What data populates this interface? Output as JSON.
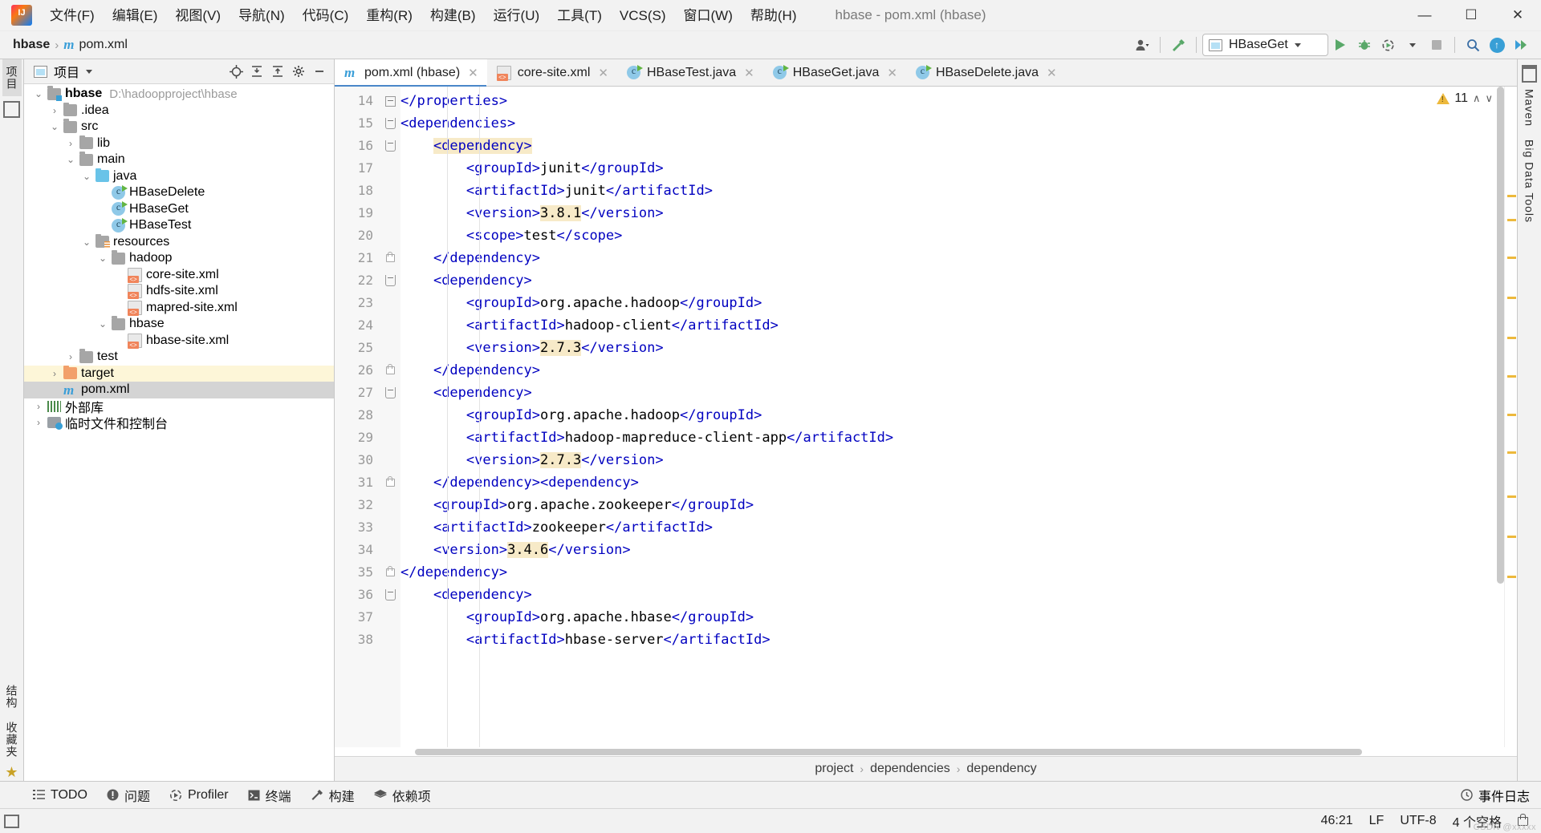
{
  "window": {
    "title": "hbase - pom.xml (hbase)",
    "minimize": "—",
    "maximize": "☐",
    "close": "✕"
  },
  "menubar": {
    "items": [
      {
        "label": "文件(F)"
      },
      {
        "label": "编辑(E)"
      },
      {
        "label": "视图(V)"
      },
      {
        "label": "导航(N)"
      },
      {
        "label": "代码(C)"
      },
      {
        "label": "重构(R)"
      },
      {
        "label": "构建(B)"
      },
      {
        "label": "运行(U)"
      },
      {
        "label": "工具(T)"
      },
      {
        "label": "VCS(S)"
      },
      {
        "label": "窗口(W)"
      },
      {
        "label": "帮助(H)"
      }
    ]
  },
  "navbar": {
    "crumbs": [
      {
        "label": "hbase",
        "bold": true
      },
      {
        "label": "pom.xml",
        "bold": false
      }
    ],
    "separator": "›",
    "run_configuration": "HBaseGet",
    "actions": {
      "avatar": "user-icon",
      "build": "hammer-icon",
      "run": "run-icon",
      "debug": "debug-icon",
      "run_with_coverage": "coverage-icon",
      "stop": "stop-icon",
      "search_everywhere": "magnifier-icon",
      "update": "update-icon",
      "search_next": "forward-icon"
    }
  },
  "left_strip": {
    "project_label": "项目",
    "structure_label": "结构",
    "favorites_label": "收藏夹"
  },
  "right_strip": {
    "maven_label": "Maven",
    "bigdata_label": "Big Data Tools"
  },
  "project_pane": {
    "title": "项目",
    "toolbar_icons": [
      "locate-icon",
      "collapse-all-icon",
      "expand-all-icon",
      "settings-gear-icon",
      "hide-icon"
    ],
    "tree": [
      {
        "depth": 0,
        "arrow": "⌄",
        "icon": "folder-module",
        "label": "hbase",
        "bold": true,
        "path": "D:\\hadoopproject\\hbase",
        "state": "normal"
      },
      {
        "depth": 1,
        "arrow": "›",
        "icon": "folder",
        "label": ".idea",
        "bold": false,
        "path": "",
        "state": "normal"
      },
      {
        "depth": 1,
        "arrow": "⌄",
        "icon": "folder",
        "label": "src",
        "bold": false,
        "path": "",
        "state": "normal"
      },
      {
        "depth": 2,
        "arrow": "›",
        "icon": "folder",
        "label": "lib",
        "bold": false,
        "path": "",
        "state": "normal"
      },
      {
        "depth": 2,
        "arrow": "⌄",
        "icon": "folder",
        "label": "main",
        "bold": false,
        "path": "",
        "state": "normal"
      },
      {
        "depth": 3,
        "arrow": "⌄",
        "icon": "folder-blue",
        "label": "java",
        "bold": false,
        "path": "",
        "state": "normal"
      },
      {
        "depth": 4,
        "arrow": "",
        "icon": "java-class",
        "label": "HBaseDelete",
        "bold": false,
        "path": "",
        "state": "normal"
      },
      {
        "depth": 4,
        "arrow": "",
        "icon": "java-class",
        "label": "HBaseGet",
        "bold": false,
        "path": "",
        "state": "normal"
      },
      {
        "depth": 4,
        "arrow": "",
        "icon": "java-class",
        "label": "HBaseTest",
        "bold": false,
        "path": "",
        "state": "normal"
      },
      {
        "depth": 3,
        "arrow": "⌄",
        "icon": "folder-resources",
        "label": "resources",
        "bold": false,
        "path": "",
        "state": "normal"
      },
      {
        "depth": 4,
        "arrow": "⌄",
        "icon": "folder",
        "label": "hadoop",
        "bold": false,
        "path": "",
        "state": "normal"
      },
      {
        "depth": 5,
        "arrow": "",
        "icon": "xml-file",
        "label": "core-site.xml",
        "bold": false,
        "path": "",
        "state": "normal"
      },
      {
        "depth": 5,
        "arrow": "",
        "icon": "xml-file",
        "label": "hdfs-site.xml",
        "bold": false,
        "path": "",
        "state": "normal"
      },
      {
        "depth": 5,
        "arrow": "",
        "icon": "xml-file",
        "label": "mapred-site.xml",
        "bold": false,
        "path": "",
        "state": "normal"
      },
      {
        "depth": 4,
        "arrow": "⌄",
        "icon": "folder",
        "label": "hbase",
        "bold": false,
        "path": "",
        "state": "normal"
      },
      {
        "depth": 5,
        "arrow": "",
        "icon": "xml-file",
        "label": "hbase-site.xml",
        "bold": false,
        "path": "",
        "state": "normal"
      },
      {
        "depth": 2,
        "arrow": "›",
        "icon": "folder",
        "label": "test",
        "bold": false,
        "path": "",
        "state": "normal"
      },
      {
        "depth": 1,
        "arrow": "›",
        "icon": "folder-orange",
        "label": "target",
        "bold": false,
        "path": "",
        "state": "highlight"
      },
      {
        "depth": 1,
        "arrow": "",
        "icon": "maven-m",
        "label": "pom.xml",
        "bold": false,
        "path": "",
        "state": "selected"
      },
      {
        "depth": 0,
        "arrow": "›",
        "icon": "libraries",
        "label": "外部库",
        "bold": false,
        "path": "",
        "state": "normal"
      },
      {
        "depth": 0,
        "arrow": "›",
        "icon": "scratches",
        "label": "临时文件和控制台",
        "bold": false,
        "path": "",
        "state": "normal"
      }
    ]
  },
  "editor": {
    "tabs": [
      {
        "label": "pom.xml (hbase)",
        "icon": "maven-m",
        "active": true,
        "close": "✕"
      },
      {
        "label": "core-site.xml",
        "icon": "xml-file",
        "active": false,
        "close": "✕"
      },
      {
        "label": "HBaseTest.java",
        "icon": "java-class",
        "active": false,
        "close": "✕"
      },
      {
        "label": "HBaseGet.java",
        "icon": "java-class",
        "active": false,
        "close": "✕"
      },
      {
        "label": "HBaseDelete.java",
        "icon": "java-class",
        "active": false,
        "close": "✕"
      }
    ],
    "inspection": {
      "count": "11",
      "up": "∧",
      "down": "∨"
    },
    "breadcrumbs": [
      "project",
      "dependencies",
      "dependency"
    ],
    "breadcrumb_separator": "›",
    "lines": [
      {
        "num": "14",
        "fold": "minus",
        "indent": 1,
        "html": "<span class=\"tag\">&lt;/properties&gt;</span>"
      },
      {
        "num": "15",
        "fold": "open",
        "indent": 1,
        "html": "<span class=\"tag\">&lt;dependencies&gt;</span>"
      },
      {
        "num": "16",
        "fold": "open",
        "indent": 2,
        "html": "    <span class=\"tag hi\">&lt;dependency&gt;</span>"
      },
      {
        "num": "17",
        "fold": "",
        "indent": 3,
        "html": "        <span class=\"tag\">&lt;groupId&gt;</span>junit<span class=\"tag\">&lt;/groupId&gt;</span>"
      },
      {
        "num": "18",
        "fold": "",
        "indent": 3,
        "html": "        <span class=\"tag\">&lt;artifactId&gt;</span>junit<span class=\"tag\">&lt;/artifactId&gt;</span>"
      },
      {
        "num": "19",
        "fold": "",
        "indent": 3,
        "html": "        <span class=\"tag\">&lt;version&gt;</span><span class=\"vhl\">3.8.1</span><span class=\"tag\">&lt;/version&gt;</span>"
      },
      {
        "num": "20",
        "fold": "",
        "indent": 3,
        "html": "        <span class=\"tag\">&lt;scope&gt;</span>test<span class=\"tag\">&lt;/scope&gt;</span>"
      },
      {
        "num": "21",
        "fold": "lock",
        "indent": 2,
        "html": "    <span class=\"tag\">&lt;/dependency&gt;</span>"
      },
      {
        "num": "22",
        "fold": "open",
        "indent": 2,
        "html": "    <span class=\"tag\">&lt;dependency&gt;</span>"
      },
      {
        "num": "23",
        "fold": "",
        "indent": 3,
        "html": "        <span class=\"tag\">&lt;groupId&gt;</span>org.apache.hadoop<span class=\"tag\">&lt;/groupId&gt;</span>"
      },
      {
        "num": "24",
        "fold": "",
        "indent": 3,
        "html": "        <span class=\"tag\">&lt;artifactId&gt;</span>hadoop-client<span class=\"tag\">&lt;/artifactId&gt;</span>"
      },
      {
        "num": "25",
        "fold": "",
        "indent": 3,
        "html": "        <span class=\"tag\">&lt;version&gt;</span><span class=\"vhl\">2.7.3</span><span class=\"tag\">&lt;/version&gt;</span>"
      },
      {
        "num": "26",
        "fold": "lock",
        "indent": 2,
        "html": "    <span class=\"tag\">&lt;/dependency&gt;</span>"
      },
      {
        "num": "27",
        "fold": "open",
        "indent": 2,
        "html": "    <span class=\"tag\">&lt;dependency&gt;</span>"
      },
      {
        "num": "28",
        "fold": "",
        "indent": 3,
        "html": "        <span class=\"tag\">&lt;groupId&gt;</span>org.apache.hadoop<span class=\"tag\">&lt;/groupId&gt;</span>"
      },
      {
        "num": "29",
        "fold": "",
        "indent": 3,
        "html": "        <span class=\"tag\">&lt;artifactId&gt;</span>hadoop-mapreduce-client-app<span class=\"tag\">&lt;/artifactId&gt;</span>"
      },
      {
        "num": "30",
        "fold": "",
        "indent": 3,
        "html": "        <span class=\"tag\">&lt;version&gt;</span><span class=\"vhl\">2.7.3</span><span class=\"tag\">&lt;/version&gt;</span>"
      },
      {
        "num": "31",
        "fold": "lock",
        "indent": 2,
        "html": "    <span class=\"tag\">&lt;/dependency&gt;&lt;dependency&gt;</span>"
      },
      {
        "num": "32",
        "fold": "",
        "indent": 2,
        "html": "    <span class=\"tag\">&lt;groupId&gt;</span>org.apache.zookeeper<span class=\"tag\">&lt;/groupId&gt;</span>"
      },
      {
        "num": "33",
        "fold": "",
        "indent": 2,
        "html": "    <span class=\"tag\">&lt;artifactId&gt;</span>zookeeper<span class=\"tag\">&lt;/artifactId&gt;</span>"
      },
      {
        "num": "34",
        "fold": "",
        "indent": 2,
        "html": "    <span class=\"tag\">&lt;version&gt;</span><span class=\"vhl\">3.4.6</span><span class=\"tag\">&lt;/version&gt;</span>"
      },
      {
        "num": "35",
        "fold": "lock",
        "indent": 1,
        "html": "<span class=\"tag\">&lt;/dependency&gt;</span>"
      },
      {
        "num": "36",
        "fold": "open",
        "indent": 2,
        "html": "    <span class=\"tag\">&lt;dependency&gt;</span>"
      },
      {
        "num": "37",
        "fold": "",
        "indent": 3,
        "html": "        <span class=\"tag\">&lt;groupId&gt;</span>org.apache.hbase<span class=\"tag\">&lt;/groupId&gt;</span>"
      },
      {
        "num": "38",
        "fold": "",
        "indent": 3,
        "html": "        <span class=\"tag\">&lt;artifactId&gt;</span>hbase-server<span class=\"tag\">&lt;/artifactId&gt;</span>"
      }
    ]
  },
  "bottom_tools": [
    {
      "label": "TODO",
      "icon": "list-icon"
    },
    {
      "label": "问题",
      "icon": "problems-icon"
    },
    {
      "label": "Profiler",
      "icon": "profiler-icon"
    },
    {
      "label": "终端",
      "icon": "terminal-icon"
    },
    {
      "label": "构建",
      "icon": "hammer-icon"
    },
    {
      "label": "依赖项",
      "icon": "layers-icon"
    }
  ],
  "bottom_right": {
    "label": "事件日志",
    "icon": "event-log-icon"
  },
  "statusbar": {
    "caret": "46:21",
    "line_separator": "LF",
    "encoding": "UTF-8",
    "indent": "4 个空格",
    "lock": "lock-icon"
  },
  "watermark": "CSDN @xxxxx"
}
